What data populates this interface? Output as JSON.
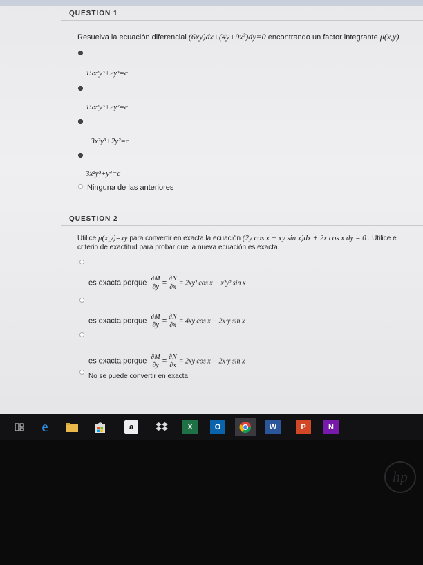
{
  "q1": {
    "label": "QUESTION 1",
    "text": "Resuelva la ecuación diferencial",
    "equation": "(6xy)dx+(4y+9x²)dy=0",
    "text2": "encontrando un factor integrante",
    "factor": "μ(x,y)",
    "options": [
      "15x²y³+2y³=c",
      "15x²y³+2y²=c",
      "−3x²y³+2y²=c",
      "3x²y³+y⁴=c",
      "Ninguna de las anteriores"
    ]
  },
  "q2": {
    "label": "QUESTION 2",
    "text_a": "Utilice",
    "mu": "μ(x,y)=xy",
    "text_b": "para convertir en exacta la ecuación",
    "equation": "(2y cos x − xy sin x)dx + 2x cos x dy = 0",
    "text_c": ". Utilice e",
    "line2": "criterio de exactitud para probar que la nueva ecuación es exacta.",
    "prefix": "es exacta porque",
    "dM": "∂M",
    "dy": "∂y",
    "dN": "∂N",
    "dx": "∂x",
    "options": [
      "= 2xy² cos x − x²y² sin x",
      "= 4xy cos x − 2x²y sin x",
      "= 2xy cos x − 2x²y sin x"
    ],
    "last_option": "No se puede convertir en exacta"
  },
  "taskbar": {
    "amazon": "a",
    "excel": "X",
    "outlook": "O",
    "word": "W",
    "powerpoint": "P",
    "onenote": "N"
  },
  "brand": "hp"
}
